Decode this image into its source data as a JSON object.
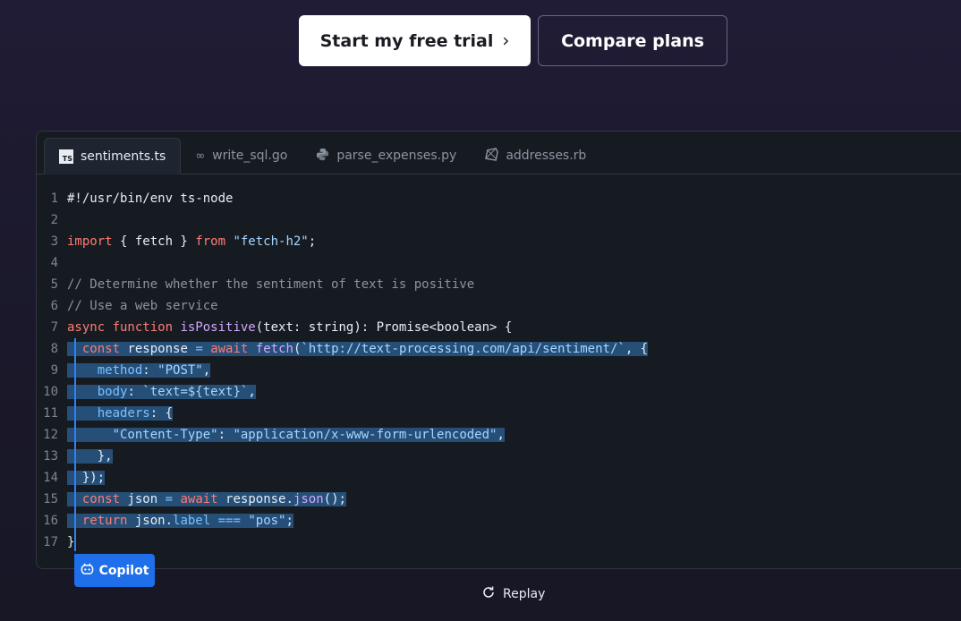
{
  "cta": {
    "primary_label": "Start my free trial",
    "secondary_label": "Compare plans"
  },
  "tabs": [
    {
      "label": "sentiments.ts",
      "icon": "ts-icon",
      "active": true
    },
    {
      "label": "write_sql.go",
      "icon": "go-icon",
      "active": false
    },
    {
      "label": "parse_expenses.py",
      "icon": "python-icon",
      "active": false
    },
    {
      "label": "addresses.rb",
      "icon": "ruby-icon",
      "active": false
    }
  ],
  "code": {
    "line_numbers": [
      "1",
      "2",
      "3",
      "4",
      "5",
      "6",
      "7",
      "8",
      "9",
      "10",
      "11",
      "12",
      "13",
      "14",
      "15",
      "16",
      "17"
    ]
  },
  "copilot_label": "Copilot",
  "replay_label": "Replay",
  "colors": {
    "selection": "#264f78",
    "accent": "#1f6feb",
    "keyword": "#ff7b72",
    "function": "#d2a8ff",
    "string": "#a5d6ff",
    "property": "#79c0ff"
  }
}
